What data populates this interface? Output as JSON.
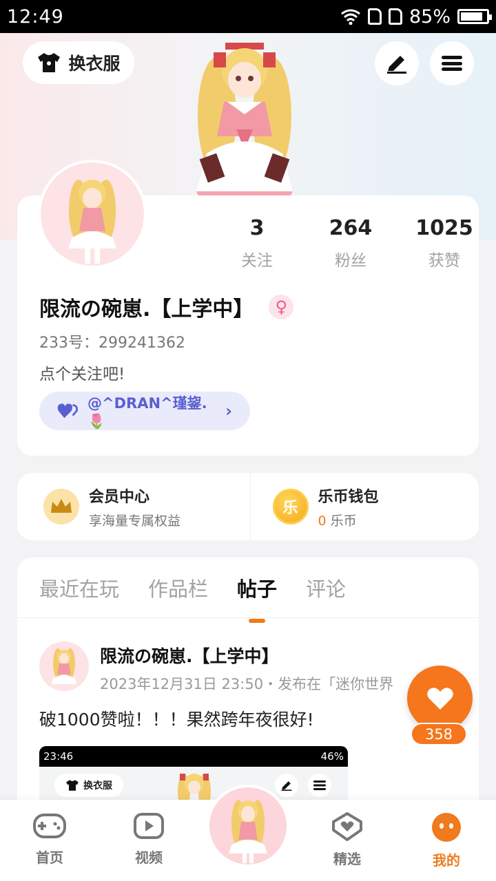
{
  "status_bar": {
    "time": "12:49",
    "battery": "85%",
    "battery_level": 0.85
  },
  "header": {
    "clothes_label": "换衣服"
  },
  "profile": {
    "stats": [
      {
        "value": "3",
        "label": "关注"
      },
      {
        "value": "264",
        "label": "粉丝"
      },
      {
        "value": "1025",
        "label": "获赞"
      }
    ],
    "username": "限流の碗崽.【上学中】",
    "gender_symbol": "♀",
    "uid": "233号：299241362",
    "bio": "点个关注吧!",
    "friend": "@^DRAN^瑾鋆.🌷"
  },
  "vip": {
    "member_title": "会员中心",
    "member_sub": "享海量专属权益",
    "wallet_title": "乐币钱包",
    "wallet_amount": "0",
    "wallet_unit": " 乐币",
    "coin_char": "乐"
  },
  "tabs": [
    {
      "label": "最近在玩",
      "active": false
    },
    {
      "label": "作品栏",
      "active": false
    },
    {
      "label": "帖子",
      "active": true
    },
    {
      "label": "评论",
      "active": false
    }
  ],
  "post": {
    "author": "限流の碗崽.【上学中】",
    "meta": "2023年12月31日 23:50・发布在「迷你世界",
    "text": "破1000赞啦！！！果然跨年夜很好!",
    "shot_time": "23:46",
    "shot_battery": "46%",
    "shot_clothes_label": "换衣服"
  },
  "like": {
    "count": "358"
  },
  "bottom_nav": [
    {
      "label": "首页",
      "icon": "gamepad-icon"
    },
    {
      "label": "视频",
      "icon": "play-icon"
    },
    {
      "label": "精选",
      "icon": "heart-badge-icon"
    },
    {
      "label": "我的",
      "icon": "face-icon",
      "active": true
    }
  ],
  "colors": {
    "accent": "#f07a1c",
    "friend_pill": "#e9ebfb",
    "friend_text": "#5a5fd0"
  }
}
